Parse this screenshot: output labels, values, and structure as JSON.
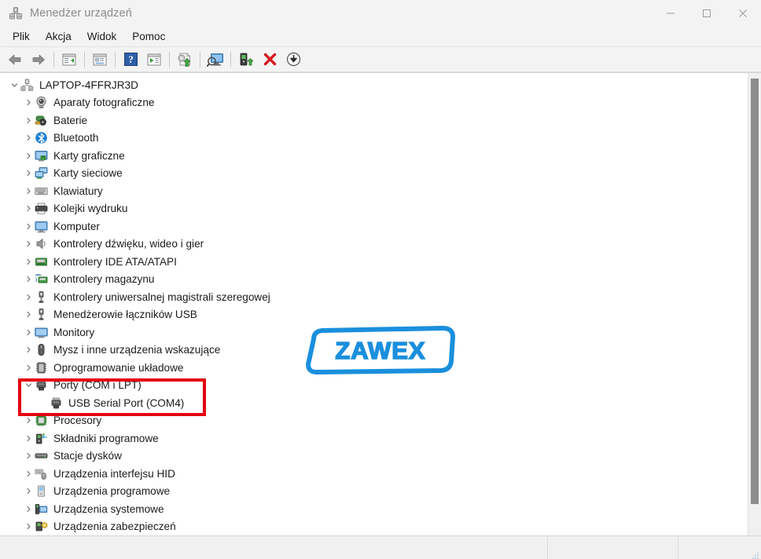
{
  "window": {
    "title": "Menedżer urządzeń",
    "title_icon": "device-manager-icon",
    "controls": {
      "minimize": "minimize-icon",
      "maximize": "maximize-icon",
      "close": "close-icon"
    }
  },
  "menubar": {
    "items": [
      {
        "label": "Plik",
        "name": "menu-plik"
      },
      {
        "label": "Akcja",
        "name": "menu-akcja"
      },
      {
        "label": "Widok",
        "name": "menu-widok"
      },
      {
        "label": "Pomoc",
        "name": "menu-pomoc"
      }
    ]
  },
  "toolbar": {
    "items": [
      {
        "icon": "back-arrow-icon"
      },
      {
        "icon": "forward-arrow-icon"
      },
      {
        "icon": "separator"
      },
      {
        "icon": "properties-panel-icon"
      },
      {
        "icon": "separator"
      },
      {
        "icon": "properties-icon"
      },
      {
        "icon": "separator"
      },
      {
        "icon": "help-icon"
      },
      {
        "icon": "show-hidden-devices-icon"
      },
      {
        "icon": "separator"
      },
      {
        "icon": "update-driver-icon"
      },
      {
        "icon": "separator"
      },
      {
        "icon": "scan-hardware-changes-icon"
      },
      {
        "icon": "separator"
      },
      {
        "icon": "enable-device-icon"
      },
      {
        "icon": "uninstall-device-icon"
      },
      {
        "icon": "download-icon"
      }
    ]
  },
  "tree": {
    "root": {
      "label": "LAPTOP-4FFRJR3D",
      "icon": "computer-root-icon",
      "expanded": true,
      "level": 0
    },
    "items": [
      {
        "label": "Aparaty fotograficzne",
        "icon": "camera-icon",
        "expanded": false,
        "level": 1
      },
      {
        "label": "Baterie",
        "icon": "battery-icon",
        "expanded": false,
        "level": 1
      },
      {
        "label": "Bluetooth",
        "icon": "bluetooth-icon",
        "expanded": false,
        "level": 1
      },
      {
        "label": "Karty graficzne",
        "icon": "display-adapter-icon",
        "expanded": false,
        "level": 1
      },
      {
        "label": "Karty sieciowe",
        "icon": "network-adapter-icon",
        "expanded": false,
        "level": 1
      },
      {
        "label": "Klawiatury",
        "icon": "keyboard-icon",
        "expanded": false,
        "level": 1
      },
      {
        "label": "Kolejki wydruku",
        "icon": "printer-icon",
        "expanded": false,
        "level": 1
      },
      {
        "label": "Komputer",
        "icon": "computer-icon",
        "expanded": false,
        "level": 1
      },
      {
        "label": "Kontrolery dźwięku, wideo i gier",
        "icon": "sound-icon",
        "expanded": false,
        "level": 1
      },
      {
        "label": "Kontrolery IDE ATA/ATAPI",
        "icon": "ide-controller-icon",
        "expanded": false,
        "level": 1
      },
      {
        "label": "Kontrolery magazynu",
        "icon": "storage-controller-icon",
        "expanded": false,
        "level": 1
      },
      {
        "label": "Kontrolery uniwersalnej magistrali szeregowej",
        "icon": "usb-controller-icon",
        "expanded": false,
        "level": 1
      },
      {
        "label": "Menedżerowie łączników USB",
        "icon": "usb-connector-icon",
        "expanded": false,
        "level": 1
      },
      {
        "label": "Monitory",
        "icon": "monitor-icon",
        "expanded": false,
        "level": 1
      },
      {
        "label": "Mysz i inne urządzenia wskazujące",
        "icon": "mouse-icon",
        "expanded": false,
        "level": 1
      },
      {
        "label": "Oprogramowanie układowe",
        "icon": "firmware-icon",
        "expanded": false,
        "level": 1
      },
      {
        "label": "Porty (COM i LPT)",
        "icon": "port-icon",
        "expanded": true,
        "level": 1,
        "highlighted": true
      },
      {
        "label": "USB Serial Port (COM4)",
        "icon": "port-icon",
        "expanded": null,
        "level": 2,
        "highlighted": true
      },
      {
        "label": "Procesory",
        "icon": "processor-icon",
        "expanded": false,
        "level": 1
      },
      {
        "label": "Składniki programowe",
        "icon": "software-component-icon",
        "expanded": false,
        "level": 1
      },
      {
        "label": "Stacje dysków",
        "icon": "disk-drive-icon",
        "expanded": false,
        "level": 1
      },
      {
        "label": "Urządzenia interfejsu HID",
        "icon": "hid-device-icon",
        "expanded": false,
        "level": 1
      },
      {
        "label": "Urządzenia programowe",
        "icon": "software-device-icon",
        "expanded": false,
        "level": 1
      },
      {
        "label": "Urządzenia systemowe",
        "icon": "system-device-icon",
        "expanded": false,
        "level": 1
      },
      {
        "label": "Urządzenia zabezpieczeń",
        "icon": "security-device-icon",
        "expanded": false,
        "level": 1
      }
    ]
  },
  "annotation": {
    "highlight_color": "#e60012",
    "shape": "rectangle"
  },
  "watermark": {
    "text": "ZAWEX",
    "color": "#1a8fdd"
  },
  "statusbar": {
    "panels": [
      "",
      "",
      ""
    ]
  },
  "scrollbar": {
    "orientation": "vertical",
    "thumb_color": "#8c8c8c"
  }
}
